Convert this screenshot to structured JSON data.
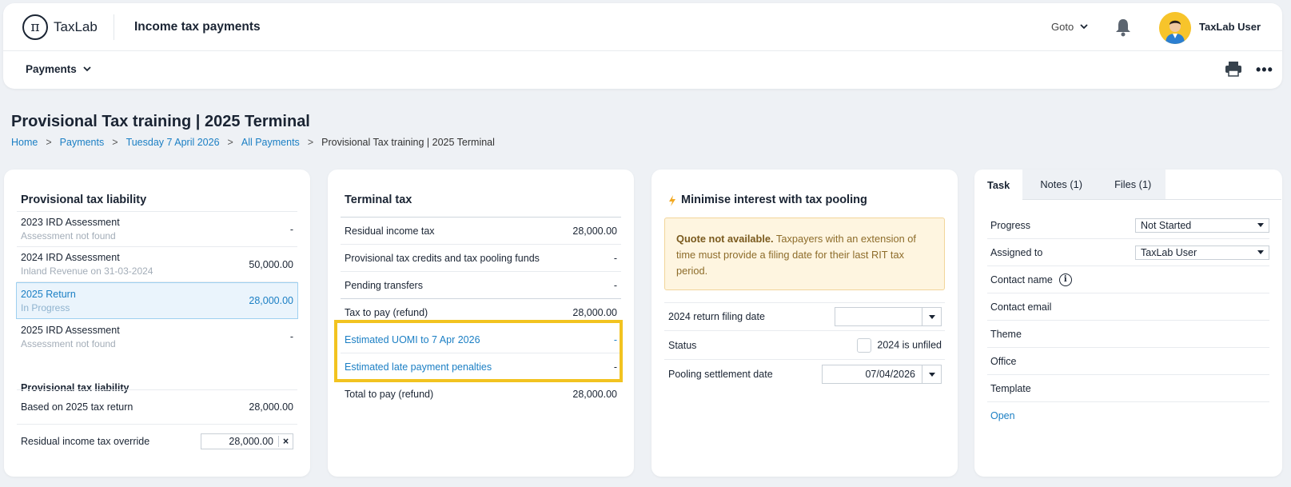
{
  "app": {
    "logo_text": "TaxLab",
    "logo_symbol": "π",
    "title": "Income tax payments",
    "goto_label": "Goto",
    "user_name": "TaxLab User"
  },
  "subnav": {
    "payments_label": "Payments",
    "more_label": "•••"
  },
  "page": {
    "title": "Provisional Tax training | 2025 Terminal",
    "breadcrumb": [
      {
        "label": "Home"
      },
      {
        "label": "Payments"
      },
      {
        "label": "Tuesday 7 April 2026"
      },
      {
        "label": "All Payments"
      },
      {
        "label": "Provisional Tax training | 2025 Terminal"
      }
    ]
  },
  "liability": {
    "title": "Provisional tax liability",
    "rows": [
      {
        "label": "2023 IRD Assessment",
        "sub": "Assessment not found",
        "value": "-"
      },
      {
        "label": "2024 IRD Assessment",
        "sub": "Inland Revenue on 31-03-2024",
        "value": "50,000.00"
      },
      {
        "label": "2025 Return",
        "sub": "In Progress",
        "value": "28,000.00"
      },
      {
        "label": "2025 IRD Assessment",
        "sub": "Assessment not found",
        "value": "-"
      }
    ],
    "section_title": "Provisional tax liability",
    "based_on_label": "Based on 2025 tax return",
    "based_on_value": "28,000.00",
    "override_label": "Residual income tax override",
    "override_value": "28,000.00",
    "override_clear": "×"
  },
  "terminal": {
    "title": "Terminal tax",
    "rows": [
      {
        "label": "Residual income tax",
        "value": "28,000.00"
      },
      {
        "label": "Provisional tax credits and tax pooling funds",
        "value": "-"
      },
      {
        "label": "Pending transfers",
        "value": "-"
      },
      {
        "label": "Tax to pay (refund)",
        "value": "28,000.00"
      },
      {
        "label": "Estimated UOMI to 7 Apr 2026",
        "value": "-"
      },
      {
        "label": "Estimated late payment penalties",
        "value": "-"
      },
      {
        "label": "Total to pay (refund)",
        "value": "28,000.00"
      }
    ]
  },
  "pooling": {
    "title": "Minimise interest with tax pooling",
    "quote_bold": "Quote not available.",
    "quote_text": " Taxpayers with an extension of time must provide a filing date for their last RIT tax period.",
    "filing_date_label": "2024 return filing date",
    "filing_date_value": "",
    "status_label": "Status",
    "status_checkbox_label": "2024 is unfiled",
    "settlement_label": "Pooling settlement date",
    "settlement_value": "07/04/2026"
  },
  "task": {
    "tabs": [
      {
        "label": "Task"
      },
      {
        "label": "Notes   (1)"
      },
      {
        "label": "Files   (1)"
      }
    ],
    "progress_label": "Progress",
    "progress_value": "Not Started",
    "assigned_label": "Assigned to",
    "assigned_value": "TaxLab User",
    "contact_name_label": "Contact name",
    "contact_email_label": "Contact email",
    "theme_label": "Theme",
    "office_label": "Office",
    "template_label": "Template",
    "open_label": "Open"
  },
  "colors": {
    "accent": "#1b7fc4",
    "highlight_border": "#f2c320",
    "warning_bg": "#fef5e0"
  }
}
